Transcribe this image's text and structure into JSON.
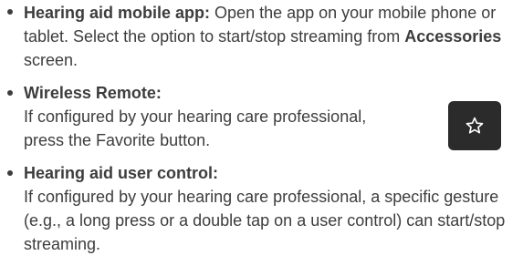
{
  "items": [
    {
      "title": "Hearing aid mobile app:",
      "text_1": "Open the app on your mobile phone or tablet. Select the option to start/stop streaming from",
      "emphasis": "Accessories",
      "text_2": "screen."
    },
    {
      "title": "Wireless Remote:",
      "text_1": "If configured by your hearing care professional,",
      "text_2": "press the Favorite button."
    },
    {
      "title": "Hearing aid user control:",
      "text_1": "If configured by your hearing care professional, a specific gesture (e.g., a long press or a double tap on a user control) can start/stop streaming."
    }
  ],
  "remote_button": {
    "icon": "star-outline-icon",
    "background": "#2b2b2b",
    "icon_color": "#ffffff"
  },
  "colors": {
    "text": "#3d3d3d"
  }
}
